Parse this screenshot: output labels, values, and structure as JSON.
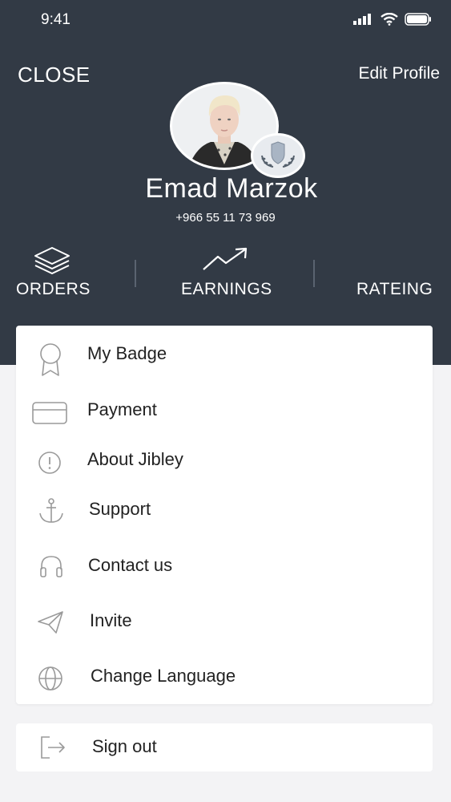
{
  "status_bar": {
    "time": "9:41"
  },
  "header": {
    "close_label": "CLOSE",
    "edit_profile_label": "Edit Profile"
  },
  "profile": {
    "name": "Emad Marzok",
    "phone": "+966 55 11 73 969"
  },
  "stats": [
    {
      "label": "ORDERS",
      "icon": "layers-icon"
    },
    {
      "label": "EARNINGS",
      "icon": "trending-up-icon"
    },
    {
      "label": "RATEING",
      "icon": ""
    }
  ],
  "menu": {
    "items": [
      {
        "label": "My Badge",
        "icon": "ribbon-badge-icon"
      },
      {
        "label": "Payment",
        "icon": "credit-card-icon"
      },
      {
        "label": "About Jibley",
        "icon": "info-circle-icon"
      },
      {
        "label": "Support",
        "icon": "anchor-icon"
      },
      {
        "label": "Contact us",
        "icon": "headphones-icon"
      },
      {
        "label": "Invite",
        "icon": "send-icon"
      },
      {
        "label": "Change Language",
        "icon": "globe-icon"
      }
    ],
    "sign_out": {
      "label": "Sign out",
      "icon": "logout-icon"
    }
  },
  "colors": {
    "header_bg": "#323a45",
    "page_bg": "#f3f3f5",
    "card_bg": "#ffffff",
    "icon_gray": "#9a9a9a"
  }
}
